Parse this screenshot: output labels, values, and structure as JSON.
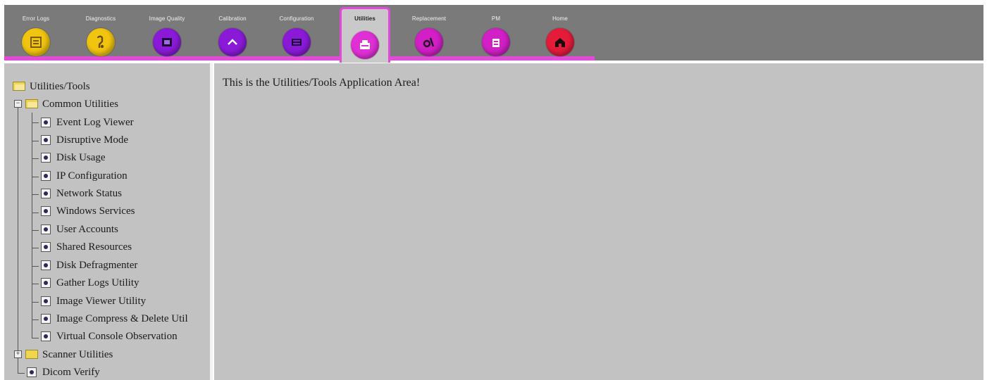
{
  "toolbar": {
    "tabs": [
      {
        "label": "Error Logs",
        "icon": "error-logs-icon",
        "color": "#f1c40f"
      },
      {
        "label": "Diagnostics",
        "icon": "diagnostics-icon",
        "color": "#f1c40f"
      },
      {
        "label": "Image Quality",
        "icon": "image-quality-icon",
        "color": "#8a1ad8"
      },
      {
        "label": "Calibration",
        "icon": "calibration-icon",
        "color": "#8a1ad8"
      },
      {
        "label": "Configuration",
        "icon": "configuration-icon",
        "color": "#8a1ad8"
      },
      {
        "label": "Utilities",
        "icon": "utilities-icon",
        "color": "#e12fd6",
        "active": true
      },
      {
        "label": "Replacement",
        "icon": "replacement-icon",
        "color": "#d21fc6"
      },
      {
        "label": "PM",
        "icon": "pm-icon",
        "color": "#d21fc6"
      },
      {
        "label": "Home",
        "icon": "home-icon",
        "color": "#e51b3a"
      }
    ],
    "accent_color": "#e14bd8"
  },
  "tree": {
    "root": "Utilities/Tools",
    "common_utilities": {
      "label": "Common Utilities",
      "items": [
        "Event Log Viewer",
        "Disruptive Mode",
        "Disk Usage",
        "IP Configuration",
        "Network Status",
        "Windows Services",
        "User Accounts",
        "Shared Resources",
        "Disk Defragmenter",
        "Gather Logs Utility",
        "Image Viewer Utility",
        "Image Compress & Delete Util",
        "Virtual Console Observation"
      ]
    },
    "scanner_utilities": "Scanner Utilities",
    "dicom_verify": "Dicom Verify"
  },
  "main": {
    "message": "This is the Utilities/Tools Application Area!"
  }
}
